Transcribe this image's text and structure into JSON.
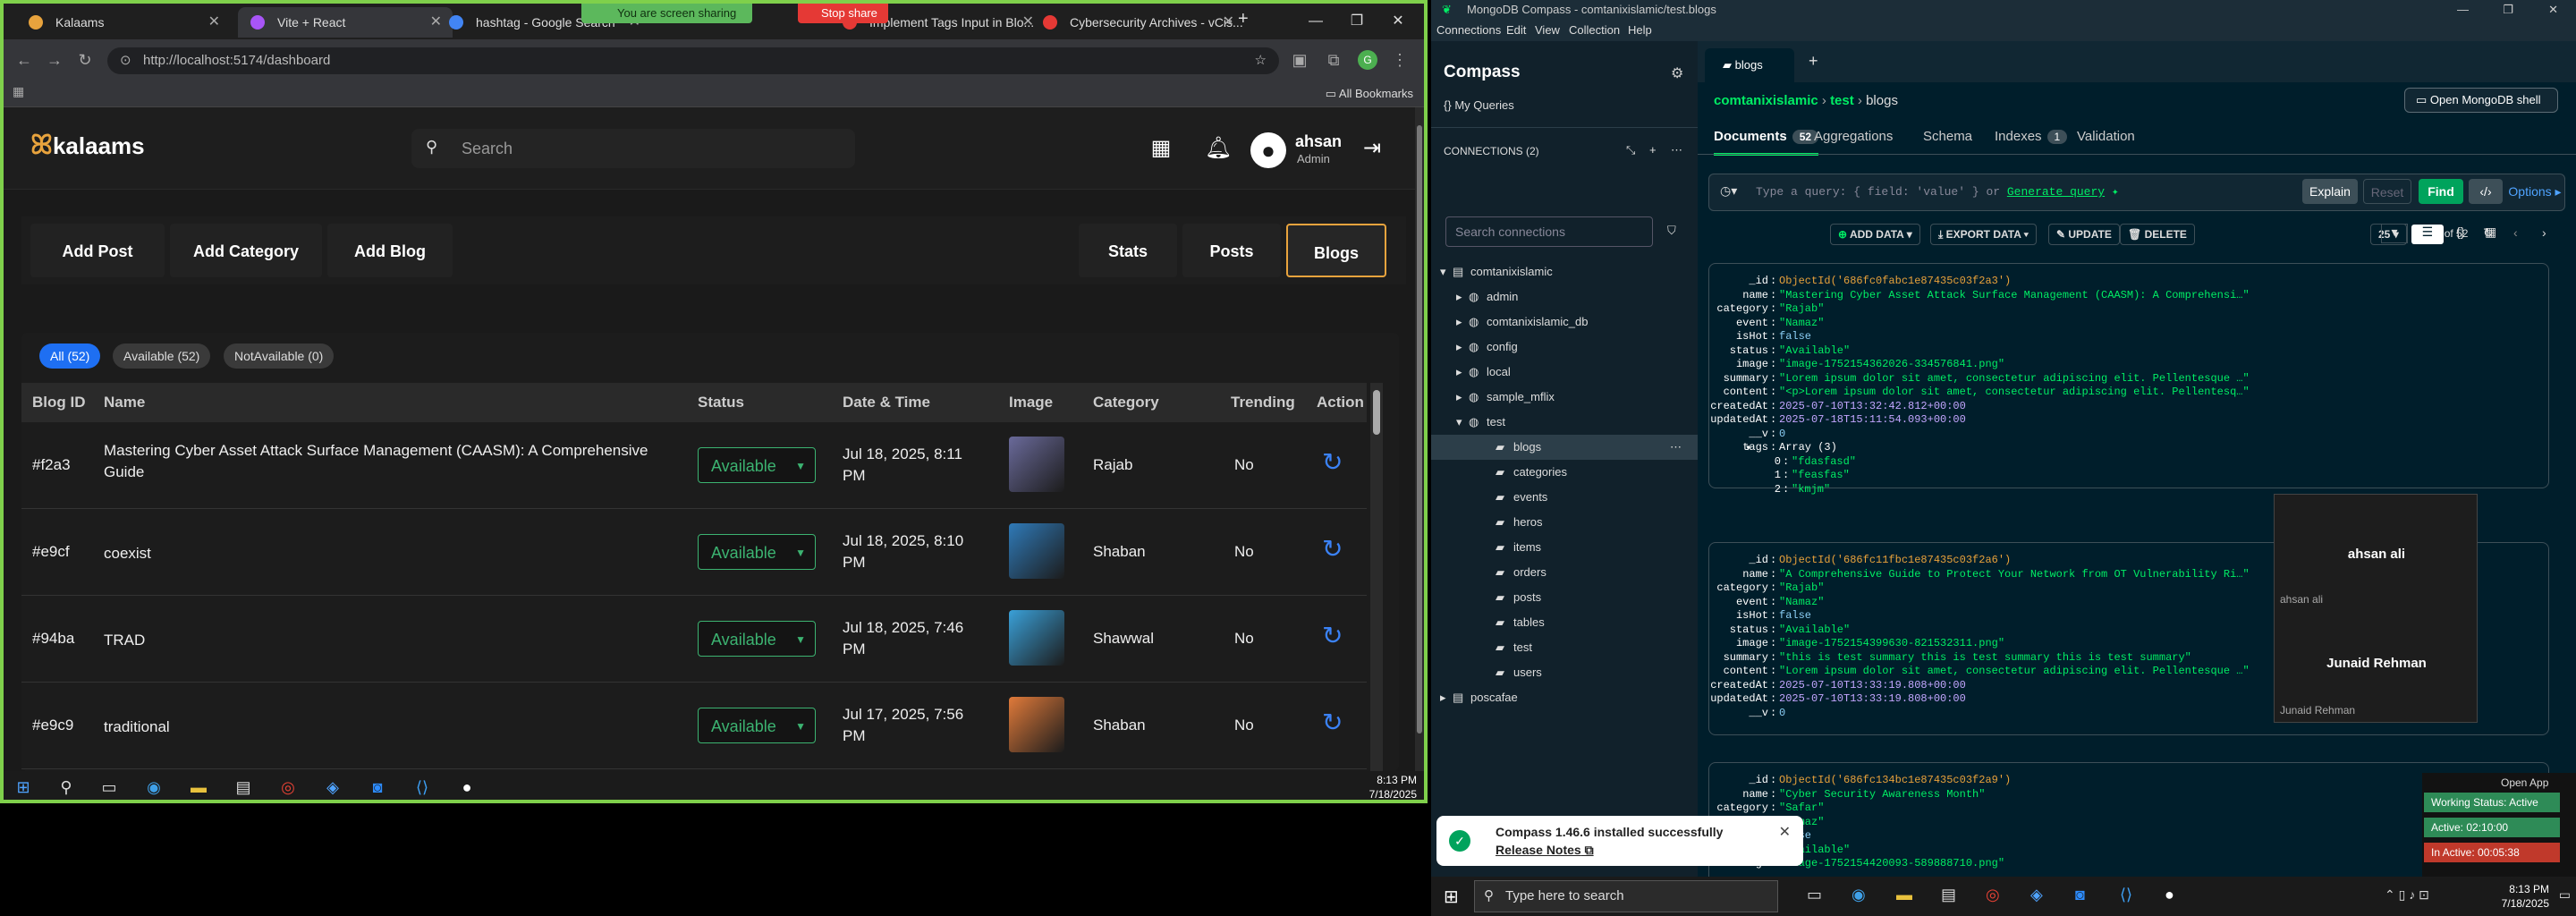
{
  "chrome": {
    "tabs": [
      {
        "title": "Kalaams",
        "color": "#e8a33d"
      },
      {
        "title": "Vite + React",
        "color": "#a855f7"
      },
      {
        "title": "hashtag - Google Search",
        "color": "#4285f4"
      },
      {
        "title": "Implement Tags Input in Blo...",
        "color": "#e53935"
      },
      {
        "title": "Cybersecurity Archives - vCis...",
        "color": "#e53935"
      }
    ],
    "sharing_text": "You are screen sharing",
    "stop_share": "Stop share",
    "url": "http://localhost:5174/dashboard",
    "all_bookmarks": "All Bookmarks"
  },
  "app": {
    "logo": "kalaams",
    "search_placeholder": "Search",
    "user_name": "ahsan",
    "user_role": "Admin",
    "toolbar_left": [
      "Add Post",
      "Add Category",
      "Add Blog"
    ],
    "toolbar_right": [
      "Stats",
      "Posts",
      "Blogs"
    ],
    "filters": [
      "All (52)",
      "Available (52)",
      "NotAvailable (0)"
    ],
    "columns": [
      "Blog ID",
      "Name",
      "Status",
      "Date & Time",
      "Image",
      "Category",
      "Trending",
      "Action"
    ],
    "rows": [
      {
        "id": "#f2a3",
        "name": "Mastering Cyber Asset Attack Surface Management (CAASM): A Comprehensive Guide",
        "status": "Available",
        "date": "Jul 18, 2025, 8:11 PM",
        "category": "Rajab",
        "trending": "No",
        "img": "#6a6a9a"
      },
      {
        "id": "#e9cf",
        "name": "coexist",
        "status": "Available",
        "date": "Jul 18, 2025, 8:10 PM",
        "category": "Shaban",
        "trending": "No",
        "img": "#2f7ab8"
      },
      {
        "id": "#94ba",
        "name": "TRAD",
        "status": "Available",
        "date": "Jul 18, 2025, 7:46 PM",
        "category": "Shawwal",
        "trending": "No",
        "img": "#3aa0d8"
      },
      {
        "id": "#e9c9",
        "name": "traditional",
        "status": "Available",
        "date": "Jul 17, 2025, 7:56 PM",
        "category": "Shaban",
        "trending": "No",
        "img": "#e07a3a"
      }
    ]
  },
  "taskbar_left": {
    "time": "8:13 PM",
    "date": "7/18/2025"
  },
  "compass": {
    "title": "MongoDB Compass - comtanixislamic/test.blogs",
    "menu": [
      "Connections",
      "Edit",
      "View",
      "Collection",
      "Help"
    ],
    "brand": "Compass",
    "my_queries": "My Queries",
    "connections_label": "CONNECTIONS (2)",
    "search_connections": "Search connections",
    "tree": [
      {
        "label": "comtanixislamic",
        "level": 0,
        "open": true
      },
      {
        "label": "admin",
        "level": 1
      },
      {
        "label": "comtanixislamic_db",
        "level": 1
      },
      {
        "label": "config",
        "level": 1
      },
      {
        "label": "local",
        "level": 1
      },
      {
        "label": "sample_mflix",
        "level": 1
      },
      {
        "label": "test",
        "level": 1,
        "open": true
      },
      {
        "label": "blogs",
        "level": 2,
        "selected": true
      },
      {
        "label": "categories",
        "level": 2
      },
      {
        "label": "events",
        "level": 2
      },
      {
        "label": "heros",
        "level": 2
      },
      {
        "label": "items",
        "level": 2
      },
      {
        "label": "orders",
        "level": 2
      },
      {
        "label": "posts",
        "level": 2
      },
      {
        "label": "tables",
        "level": 2
      },
      {
        "label": "test",
        "level": 2
      },
      {
        "label": "users",
        "level": 2
      },
      {
        "label": "poscafae",
        "level": 0
      }
    ],
    "tab_label": "blogs",
    "breadcrumb": [
      "comtanixislamic",
      "test",
      "blogs"
    ],
    "open_shell": "Open MongoDB shell",
    "subtabs": [
      {
        "label": "Documents",
        "badge": "52"
      },
      {
        "label": "Aggregations"
      },
      {
        "label": "Schema"
      },
      {
        "label": "Indexes",
        "badge": "1"
      },
      {
        "label": "Validation"
      }
    ],
    "query_placeholder": "Type a query: { field: 'value' } or",
    "generate_query": "Generate query",
    "buttons": {
      "explain": "Explain",
      "reset": "Reset",
      "find": "Find",
      "options": "Options"
    },
    "actions": [
      "ADD DATA",
      "EXPORT DATA",
      "UPDATE",
      "DELETE"
    ],
    "page_size": "25",
    "page_range": "1 – 25 of 52",
    "doc1": [
      [
        "_id",
        "ObjectId('686fc0fabc1e87435c03f2a3')",
        "oid"
      ],
      [
        "name",
        "\"Mastering Cyber Asset Attack Surface Management (CAASM): A Comprehensi…\"",
        "str"
      ],
      [
        "category",
        "\"Rajab\"",
        "str"
      ],
      [
        "event",
        "\"Namaz\"",
        "str"
      ],
      [
        "isHot",
        "false",
        "num"
      ],
      [
        "status",
        "\"Available\"",
        "str"
      ],
      [
        "image",
        "\"image-1752154362026-334576841.png\"",
        "str"
      ],
      [
        "summary",
        "\"Lorem ipsum dolor sit amet, consectetur adipiscing elit. Pellentesque …\"",
        "str"
      ],
      [
        "content",
        "\"<p>Lorem ipsum dolor sit amet, consectetur adipiscing elit. Pellentesq…\"",
        "str"
      ],
      [
        "createdAt",
        "2025-07-10T13:32:42.812+00:00",
        "date"
      ],
      [
        "updatedAt",
        "2025-07-18T15:11:54.093+00:00",
        "date"
      ],
      [
        "__v",
        "0",
        "num"
      ],
      [
        "tags",
        "Array (3)",
        "k"
      ],
      [
        "0",
        "\"fdasfasd\"",
        "str"
      ],
      [
        "1",
        "\"feasfas\"",
        "str"
      ],
      [
        "2",
        "\"kmjm\"",
        "str"
      ]
    ],
    "doc2": [
      [
        "_id",
        "ObjectId('686fc11fbc1e87435c03f2a6')",
        "oid"
      ],
      [
        "name",
        "\"A Comprehensive Guide to Protect Your Network from OT Vulnerability Ri…\"",
        "str"
      ],
      [
        "category",
        "\"Rajab\"",
        "str"
      ],
      [
        "event",
        "\"Namaz\"",
        "str"
      ],
      [
        "isHot",
        "false",
        "num"
      ],
      [
        "status",
        "\"Available\"",
        "str"
      ],
      [
        "image",
        "\"image-1752154399630-821532311.png\"",
        "str"
      ],
      [
        "summary",
        "\"this is test summary this is test summary this is test summary\"",
        "str"
      ],
      [
        "content",
        "\"Lorem ipsum dolor sit amet, consectetur adipiscing elit. Pellentesque …\"",
        "str"
      ],
      [
        "createdAt",
        "2025-07-10T13:33:19.808+00:00",
        "date"
      ],
      [
        "updatedAt",
        "2025-07-10T13:33:19.808+00:00",
        "date"
      ],
      [
        "__v",
        "0",
        "num"
      ]
    ],
    "doc3": [
      [
        "_id",
        "ObjectId('686fc134bc1e87435c03f2a9')",
        "oid"
      ],
      [
        "name",
        "\"Cyber Security Awareness Month\"",
        "str"
      ],
      [
        "category",
        "\"Safar\"",
        "str"
      ],
      [
        "event",
        "\"Namaz\"",
        "str"
      ],
      [
        "isHot",
        "false",
        "num"
      ],
      [
        "status",
        "\"Available\"",
        "str"
      ],
      [
        "image",
        "\"image-1752154420093-589888710.png\"",
        "str"
      ]
    ],
    "popup": {
      "name1": "ahsan ali",
      "sub1": "ahsan ali",
      "name2": "Junaid Rehman",
      "sub2": "Junaid Rehman"
    },
    "toast_title": "Compass 1.46.6 installed successfully",
    "toast_link": "Release Notes"
  },
  "side_status": {
    "open_app": "Open App",
    "working": "Working Status: Active",
    "active": "Active: 02:10:00",
    "inactive": "In Active: 00:05:38"
  },
  "taskbar_bottom": {
    "search": "Type here to search",
    "time": "8:13 PM",
    "date": "7/18/2025"
  }
}
